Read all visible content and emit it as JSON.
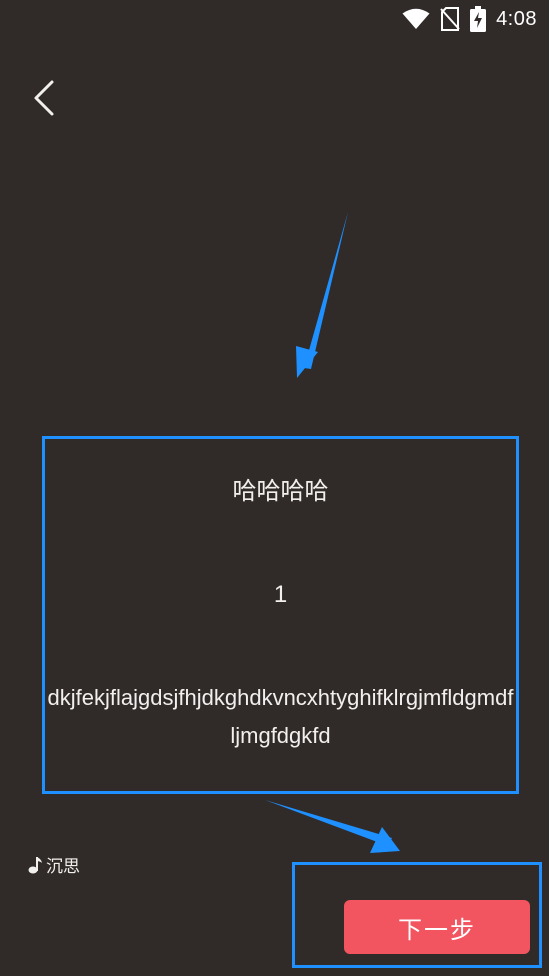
{
  "status_bar": {
    "time": "4:08",
    "icons": [
      "wifi-icon",
      "no-sim-icon",
      "battery-charging-icon"
    ]
  },
  "nav": {
    "back_icon": "chevron-left-icon"
  },
  "card": {
    "title": "哈哈哈哈",
    "number": "1",
    "body": "dkjfekjflajgdsjfhjdkghdkvncxhtyghifklrgjmfldgmdfljmgfdgkfd"
  },
  "music": {
    "icon": "music-note-icon",
    "label": "沉思"
  },
  "next_button": {
    "label": "下一步"
  },
  "colors": {
    "background": "#302b28",
    "annotation": "#1e90ff",
    "button": "#f25560"
  }
}
